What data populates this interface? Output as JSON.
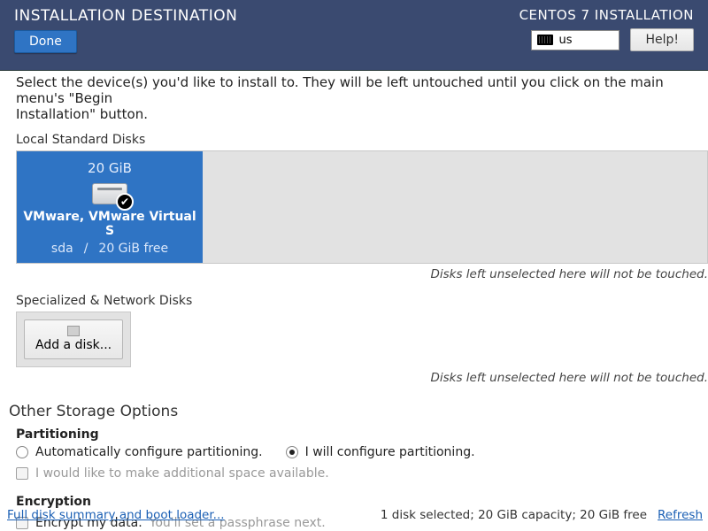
{
  "header": {
    "title": "INSTALLATION DESTINATION",
    "done": "Done",
    "installer": "CENTOS 7 INSTALLATION",
    "lang": "us",
    "help": "Help!"
  },
  "intro_line1": "Select the device(s) you'd like to install to.  They will be left untouched until you click on the main menu's \"Begin",
  "intro_line2": "Installation\" button.",
  "sections": {
    "local_disks": "Local Standard Disks",
    "network_disks": "Specialized & Network Disks",
    "other": "Other Storage Options",
    "partitioning": "Partitioning",
    "encryption": "Encryption"
  },
  "disk": {
    "size": "20 GiB",
    "name": "VMware, VMware Virtual S",
    "dev": "sda",
    "sep": "/",
    "free": "20 GiB free"
  },
  "hints": {
    "unselected": "Disks left unselected here will not be touched."
  },
  "add_disk": "Add a disk...",
  "partitioning": {
    "auto": "Automatically configure partitioning.",
    "manual": "I will configure partitioning.",
    "makespace": "I would like to make additional space available."
  },
  "encryption": {
    "encrypt": "Encrypt my data.",
    "note": "You'll set a passphrase next."
  },
  "footer": {
    "summary_link": "Full disk summary and boot loader...",
    "status": "1 disk selected; 20 GiB capacity; 20 GiB free",
    "refresh": "Refresh"
  }
}
